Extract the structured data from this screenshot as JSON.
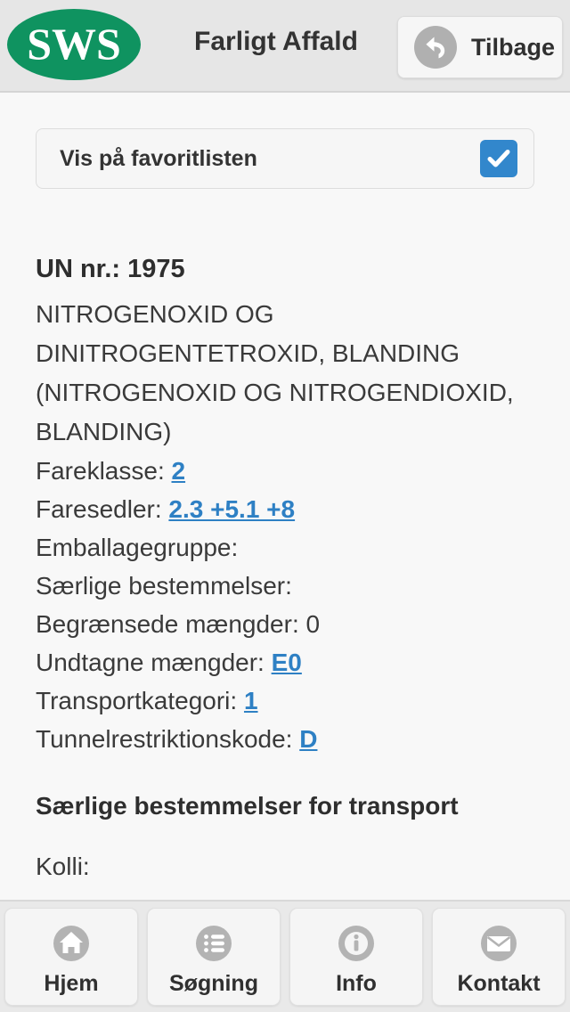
{
  "header": {
    "logo_text": "SWS",
    "logo_color": "#0f9360",
    "title": "Farligt Affald",
    "back_label": "Tilbage",
    "back_icon": "back-arrow-icon"
  },
  "favorite": {
    "label": "Vis på favoritlisten",
    "checked": true,
    "checkbox_color": "#3287cc",
    "check_icon": "checkmark-icon"
  },
  "detail": {
    "un_heading": "UN nr.: 1975",
    "substance_name": "NITROGENOXID OG DINITROGENTETROXID, BLANDING (NITROGENOXID OG NITROGENDIOXID, BLANDING)",
    "link_color": "#2e80c4",
    "properties": [
      {
        "label": "Fareklasse:",
        "value": "2",
        "link": true
      },
      {
        "label": "Faresedler:",
        "value": "2.3 +5.1 +8",
        "link": true
      },
      {
        "label": "Emballagegruppe:",
        "value": "",
        "link": false
      },
      {
        "label": "Særlige bestemmelser:",
        "value": "",
        "link": false
      },
      {
        "label": "Begrænsede mængder:",
        "value": "0",
        "link": false
      },
      {
        "label": "Undtagne mængder:",
        "value": "E0",
        "link": true
      },
      {
        "label": "Transportkategori:",
        "value": "1",
        "link": true
      },
      {
        "label": "Tunnelrestriktionskode:",
        "value": "D",
        "link": true
      }
    ],
    "section_heading": "Særlige bestemmelser for transport",
    "kolli_label": "Kolli:"
  },
  "tabbar": {
    "items": [
      {
        "label": "Hjem",
        "icon": "home-icon"
      },
      {
        "label": "Søgning",
        "icon": "list-icon"
      },
      {
        "label": "Info",
        "icon": "info-icon"
      },
      {
        "label": "Kontakt",
        "icon": "envelope-icon"
      }
    ]
  }
}
